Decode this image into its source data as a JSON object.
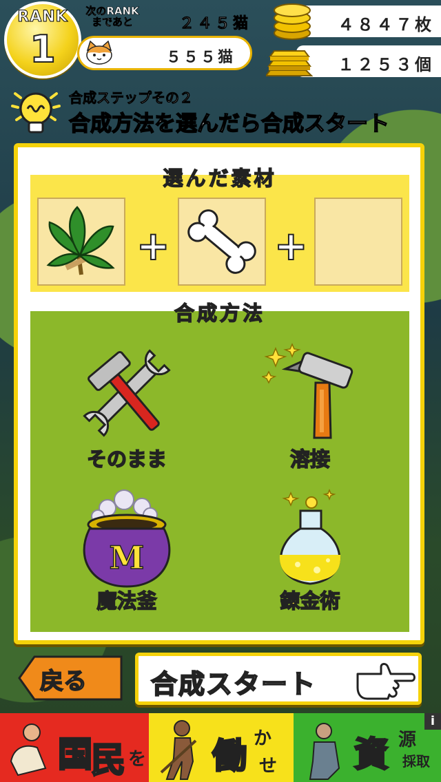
{
  "hud": {
    "rank_label": "RANK",
    "rank_value": "1",
    "next_rank_line1": "次のRANK",
    "next_rank_line2": "まであと",
    "next_rank_count": "２４５猫",
    "cats_count": "５５５猫",
    "coins": "４８４７枚",
    "gold": "１２５３個"
  },
  "hint": {
    "step_label": "合成ステップその２",
    "step_title": "合成方法を選んだら合成スタート"
  },
  "materials": {
    "title": "選んだ素材",
    "slots": [
      "herb",
      "bone",
      "empty"
    ],
    "plus": "+"
  },
  "methods": {
    "title": "合成方法",
    "items": [
      {
        "label": "そのまま",
        "icon": "tools-icon"
      },
      {
        "label": "溶接",
        "icon": "welding-torch-icon"
      },
      {
        "label": "魔法釜",
        "icon": "magic-pot-icon"
      },
      {
        "label": "錬金術",
        "icon": "alchemy-flask-icon"
      }
    ]
  },
  "buttons": {
    "back": "戻る",
    "start": "合成スタート"
  },
  "banner": {
    "left_big1": "国",
    "left_big2": "民",
    "left_small": "を",
    "mid_big": "働",
    "mid_small1": "か",
    "mid_small2": "せ",
    "right_big": "資",
    "right_small1": "源",
    "right_small2": "採取",
    "info": "i"
  },
  "colors": {
    "panel_border": "#f5d20a",
    "materials_bg": "#fbe54a",
    "methods_bg": "#8cb82a",
    "label_yellow": "#ffe23a"
  }
}
